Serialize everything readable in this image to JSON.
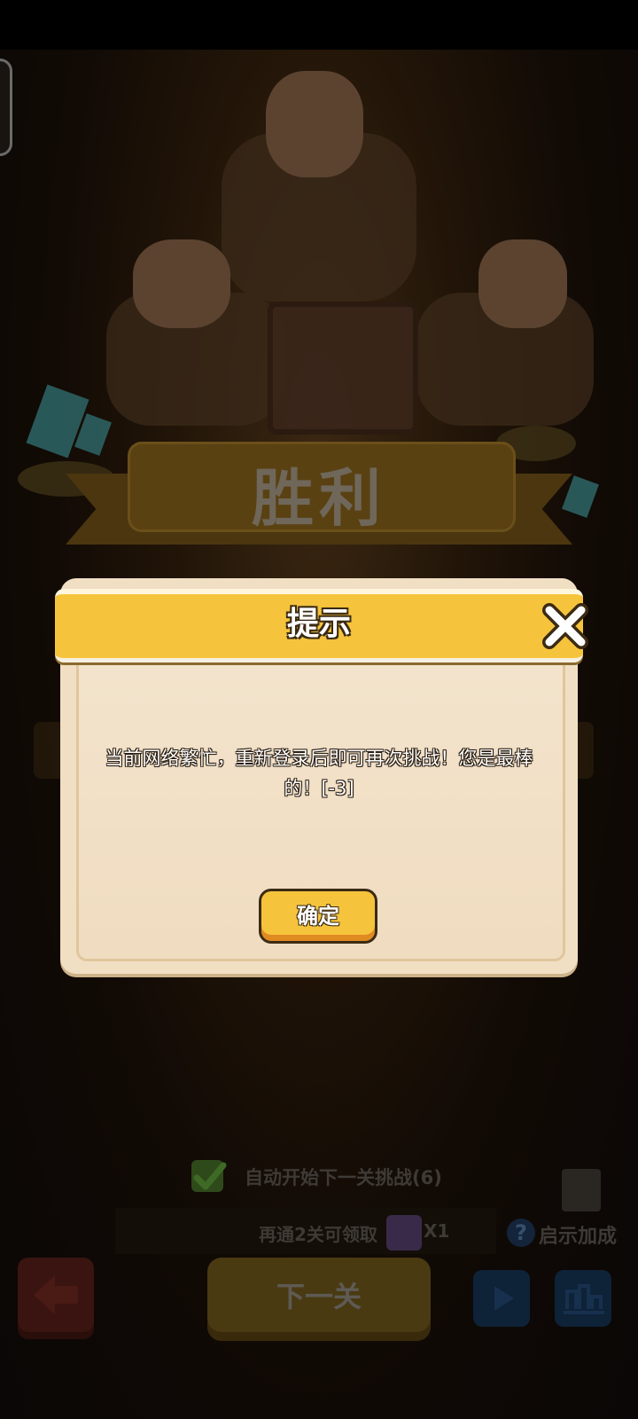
{
  "background": {
    "victory_title": "胜利"
  },
  "dialog": {
    "title": "提示",
    "message": "当前网络繁忙，重新登录后即可再次挑战！您是最棒的！[-3]",
    "ok_label": "确定"
  },
  "bottom": {
    "auto_next_label": "自动开始下一关挑战(6)",
    "promo_text": "再通2关可领取",
    "promo_count": "X1",
    "hint_label": "启示加成",
    "next_level_label": "下一关"
  },
  "colors": {
    "dialog_header": "#f6c43c",
    "dialog_body": "#f1dfc4",
    "ok_button": "#f6c43c"
  }
}
